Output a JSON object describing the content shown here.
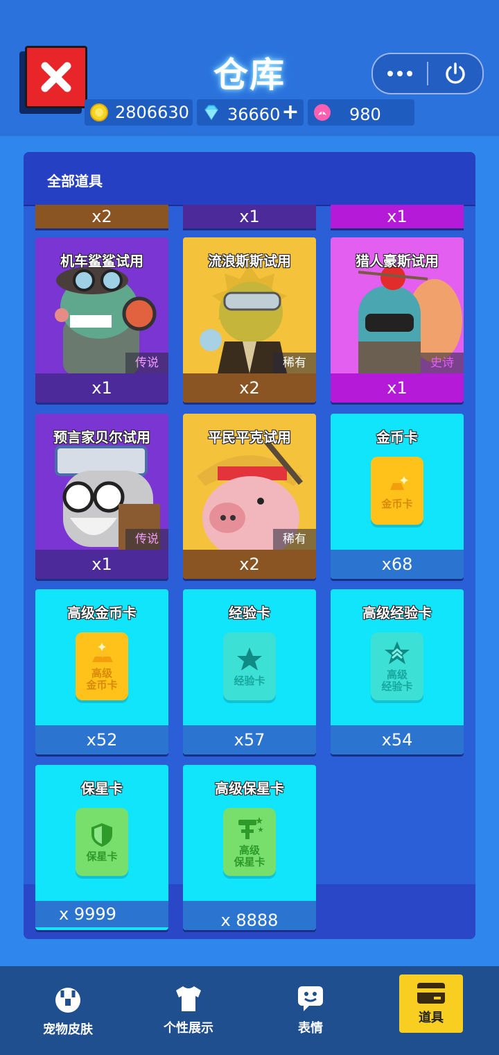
{
  "header": {
    "title": "仓库",
    "currencies": {
      "coins": "2806630",
      "gems": "36660",
      "gem_plus": "+",
      "lotus": "980"
    }
  },
  "panel": {
    "title": "全部道具",
    "partial_row": [
      "x2",
      "x1",
      "x1"
    ],
    "items": [
      {
        "name": "机车鲨鲨试用",
        "rarity": "传说",
        "count": "x1"
      },
      {
        "name": "流浪斯斯试用",
        "rarity": "稀有",
        "count": "x2"
      },
      {
        "name": "猎人豪斯试用",
        "rarity": "史诗",
        "count": "x1"
      },
      {
        "name": "预言家贝尔试用",
        "rarity": "传说",
        "count": "x1"
      },
      {
        "name": "平民平克试用",
        "rarity": "稀有",
        "count": "x2"
      },
      {
        "name": "金币卡",
        "count": "x68",
        "icon_label": "金币卡"
      },
      {
        "name": "高级金币卡",
        "count": "x52",
        "icon_label_1": "高级",
        "icon_label_2": "金币卡"
      },
      {
        "name": "经验卡",
        "count": "x57",
        "icon_label": "经验卡"
      },
      {
        "name": "高级经验卡",
        "count": "x54",
        "icon_label_1": "高级",
        "icon_label_2": "经验卡"
      },
      {
        "name": "保星卡",
        "count": "x 9999",
        "icon_label": "保星卡"
      },
      {
        "name": "高级保星卡",
        "count": "x 8888",
        "icon_label_1": "高级",
        "icon_label_2": "保星卡"
      }
    ]
  },
  "nav": {
    "items": [
      {
        "label": "宠物皮肤",
        "icon": "pet-skin-icon"
      },
      {
        "label": "个性展示",
        "icon": "tshirt-icon"
      },
      {
        "label": "表情",
        "icon": "emoji-chat-icon"
      },
      {
        "label": "道具",
        "icon": "card-icon",
        "active": true
      }
    ]
  },
  "colors": {
    "legend": "#f29bff",
    "rare": "#ffffff",
    "epic": "#e35ff4",
    "active_tab": "#f8cf20"
  }
}
